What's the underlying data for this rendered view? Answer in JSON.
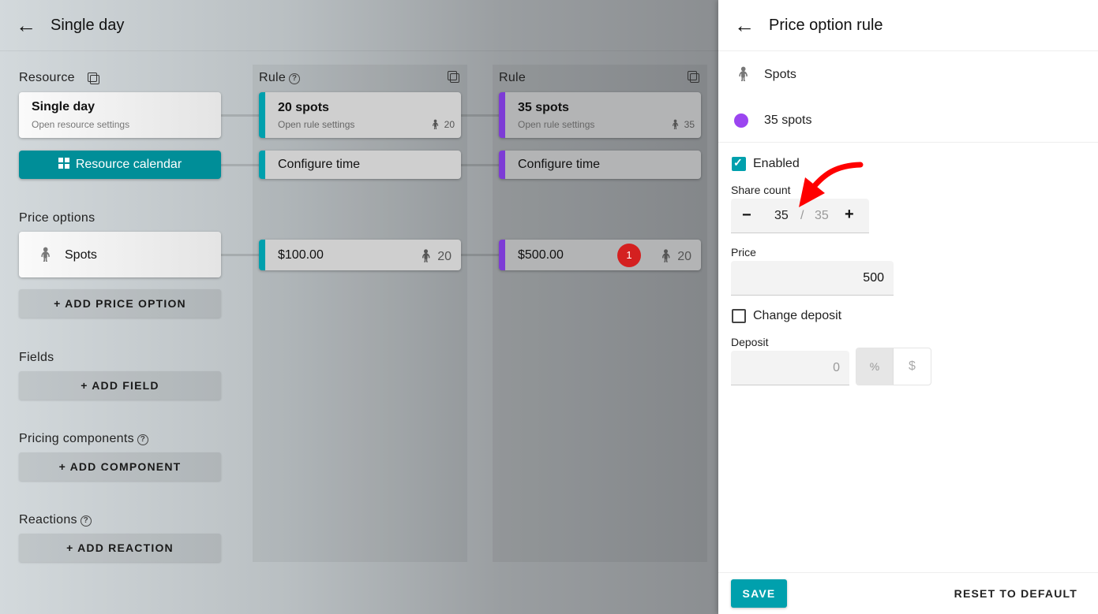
{
  "header": {
    "title": "Single day"
  },
  "left": {
    "resource_label": "Resource",
    "resource_card": {
      "title": "Single day",
      "subtitle": "Open resource settings"
    },
    "calendar_button": "Resource calendar",
    "price_options_label": "Price options",
    "price_option": "Spots",
    "add_price_option": "ADD PRICE OPTION",
    "fields_label": "Fields",
    "add_field": "ADD FIELD",
    "pricing_components_label": "Pricing components",
    "add_component": "ADD COMPONENT",
    "reactions_label": "Reactions",
    "add_reaction": "ADD REACTION"
  },
  "rules": [
    {
      "label": "Rule",
      "title": "20 spots",
      "subtitle": "Open rule settings",
      "count": "20",
      "configure": "Configure time",
      "price": "$100.00",
      "price_count": "20",
      "color": "#00a0ad"
    },
    {
      "label": "Rule",
      "title": "35 spots",
      "subtitle": "Open rule settings",
      "count": "35",
      "configure": "Configure time",
      "price": "$500.00",
      "price_count": "20",
      "badge": "1",
      "color": "#7d3bd6"
    }
  ],
  "panel": {
    "title": "Price option rule",
    "price_option": "Spots",
    "rule": "35 spots",
    "enabled_label": "Enabled",
    "enabled": true,
    "share_count_label": "Share count",
    "share_count": "35",
    "share_max": "35",
    "price_label": "Price",
    "price": "500",
    "change_deposit_label": "Change deposit",
    "change_deposit": false,
    "deposit_label": "Deposit",
    "deposit": "0",
    "unit_percent": "%",
    "unit_dollar": "$",
    "save": "SAVE",
    "reset": "RESET TO DEFAULT"
  }
}
